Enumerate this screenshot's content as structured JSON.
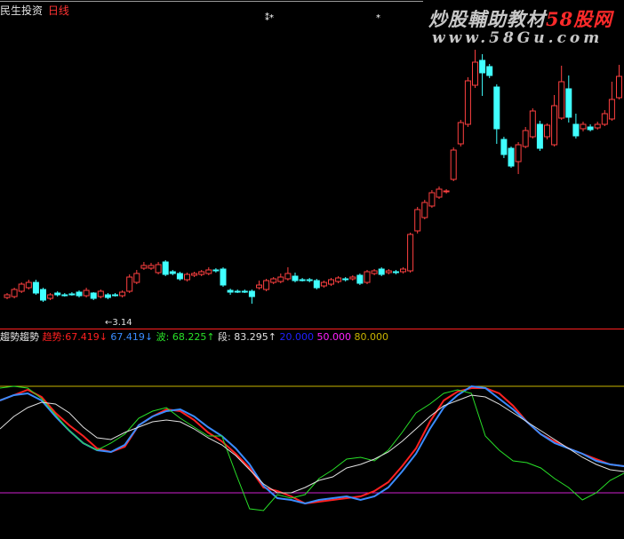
{
  "header": {
    "stock_name": "民生投资",
    "period": "日线"
  },
  "watermark": {
    "line1_white": "炒股輔助教材",
    "line1_red": "58股网",
    "line2": "www.58Gu.com"
  },
  "markers": {
    "star1": "⁑",
    "star2": "*"
  },
  "price_panel": {
    "low_label": "←3.14"
  },
  "indicator": {
    "name": "趨勢趨勢",
    "labels": [
      {
        "text": "趋势:",
        "color": "#ff2020"
      },
      {
        "text": "67.419↓",
        "color": "#ff2020"
      },
      {
        "text": " 67.419↓",
        "color": "#3a8cff"
      },
      {
        "text": " 波: ",
        "color": "#28e028"
      },
      {
        "text": "68.225↑",
        "color": "#28e028"
      },
      {
        "text": " 段: ",
        "color": "#e0e0e0"
      },
      {
        "text": "83.295↑",
        "color": "#e0e0e0"
      },
      {
        "text": " 20.000",
        "color": "#2020ff"
      },
      {
        "text": " 50.000",
        "color": "#ff20ff"
      },
      {
        "text": " 80.000",
        "color": "#c8b400"
      }
    ]
  },
  "chart_data": [
    {
      "type": "candlestick",
      "low_annotation": 3.14,
      "candles": [
        {
          "o": 35,
          "c": 38,
          "h": 40,
          "l": 33,
          "up": true
        },
        {
          "o": 36,
          "c": 44,
          "h": 46,
          "l": 34,
          "up": true
        },
        {
          "o": 42,
          "c": 50,
          "h": 52,
          "l": 40,
          "up": true
        },
        {
          "o": 46,
          "c": 52,
          "h": 55,
          "l": 44,
          "up": true
        },
        {
          "o": 52,
          "c": 40,
          "h": 55,
          "l": 38,
          "up": false
        },
        {
          "o": 44,
          "c": 32,
          "h": 46,
          "l": 30,
          "up": false
        },
        {
          "o": 34,
          "c": 38,
          "h": 40,
          "l": 32,
          "up": true
        },
        {
          "o": 40,
          "c": 38,
          "h": 42,
          "l": 36,
          "up": false
        },
        {
          "o": 38,
          "c": 38,
          "h": 40,
          "l": 36,
          "up": false
        },
        {
          "o": 39,
          "c": 39,
          "h": 41,
          "l": 37,
          "up": false
        },
        {
          "o": 41,
          "c": 37,
          "h": 43,
          "l": 35,
          "up": false
        },
        {
          "o": 37,
          "c": 43,
          "h": 46,
          "l": 35,
          "up": true
        },
        {
          "o": 40,
          "c": 34,
          "h": 41,
          "l": 32,
          "up": false
        },
        {
          "o": 36,
          "c": 42,
          "h": 44,
          "l": 34,
          "up": true
        },
        {
          "o": 38,
          "c": 35,
          "h": 40,
          "l": 33,
          "up": false
        },
        {
          "o": 38,
          "c": 38,
          "h": 40,
          "l": 36,
          "up": false
        },
        {
          "o": 37,
          "c": 41,
          "h": 43,
          "l": 35,
          "up": true
        },
        {
          "o": 42,
          "c": 58,
          "h": 61,
          "l": 40,
          "up": true
        },
        {
          "o": 52,
          "c": 62,
          "h": 66,
          "l": 50,
          "up": true
        },
        {
          "o": 68,
          "c": 71,
          "h": 75,
          "l": 66,
          "up": true
        },
        {
          "o": 68,
          "c": 71,
          "h": 74,
          "l": 66,
          "up": true
        },
        {
          "o": 63,
          "c": 72,
          "h": 75,
          "l": 61,
          "up": true
        },
        {
          "o": 75,
          "c": 61,
          "h": 77,
          "l": 59,
          "up": false
        },
        {
          "o": 64,
          "c": 62,
          "h": 66,
          "l": 60,
          "up": false
        },
        {
          "o": 62,
          "c": 56,
          "h": 64,
          "l": 54,
          "up": false
        },
        {
          "o": 55,
          "c": 61,
          "h": 63,
          "l": 53,
          "up": true
        },
        {
          "o": 60,
          "c": 62,
          "h": 64,
          "l": 58,
          "up": true
        },
        {
          "o": 61,
          "c": 64,
          "h": 66,
          "l": 59,
          "up": true
        },
        {
          "o": 62,
          "c": 66,
          "h": 69,
          "l": 60,
          "up": true
        },
        {
          "o": 66,
          "c": 65,
          "h": 68,
          "l": 63,
          "up": false
        },
        {
          "o": 67,
          "c": 49,
          "h": 69,
          "l": 47,
          "up": false
        },
        {
          "o": 43,
          "c": 41,
          "h": 45,
          "l": 38,
          "up": false
        },
        {
          "o": 42,
          "c": 42,
          "h": 44,
          "l": 40,
          "up": false
        },
        {
          "o": 42,
          "c": 42,
          "h": 44,
          "l": 40,
          "up": false
        },
        {
          "o": 42,
          "c": 36,
          "h": 44,
          "l": 28,
          "up": false
        },
        {
          "o": 46,
          "c": 49,
          "h": 54,
          "l": 44,
          "up": true
        },
        {
          "o": 44,
          "c": 54,
          "h": 56,
          "l": 42,
          "up": true
        },
        {
          "o": 52,
          "c": 56,
          "h": 58,
          "l": 50,
          "up": true
        },
        {
          "o": 53,
          "c": 58,
          "h": 62,
          "l": 51,
          "up": true
        },
        {
          "o": 56,
          "c": 62,
          "h": 69,
          "l": 54,
          "up": true
        },
        {
          "o": 59,
          "c": 54,
          "h": 63,
          "l": 52,
          "up": false
        },
        {
          "o": 55,
          "c": 55,
          "h": 57,
          "l": 53,
          "up": false
        },
        {
          "o": 55,
          "c": 54,
          "h": 57,
          "l": 52,
          "up": false
        },
        {
          "o": 54,
          "c": 46,
          "h": 56,
          "l": 44,
          "up": false
        },
        {
          "o": 48,
          "c": 52,
          "h": 54,
          "l": 46,
          "up": true
        },
        {
          "o": 50,
          "c": 55,
          "h": 57,
          "l": 48,
          "up": true
        },
        {
          "o": 53,
          "c": 57,
          "h": 59,
          "l": 51,
          "up": true
        },
        {
          "o": 56,
          "c": 55,
          "h": 58,
          "l": 53,
          "up": false
        },
        {
          "o": 56,
          "c": 58,
          "h": 60,
          "l": 54,
          "up": true
        },
        {
          "o": 60,
          "c": 51,
          "h": 62,
          "l": 49,
          "up": false
        },
        {
          "o": 52,
          "c": 64,
          "h": 66,
          "l": 50,
          "up": true
        },
        {
          "o": 62,
          "c": 65,
          "h": 67,
          "l": 60,
          "up": true
        },
        {
          "o": 67,
          "c": 61,
          "h": 69,
          "l": 59,
          "up": false
        },
        {
          "o": 63,
          "c": 65,
          "h": 67,
          "l": 61,
          "up": true
        },
        {
          "o": 64,
          "c": 63,
          "h": 66,
          "l": 61,
          "up": false
        },
        {
          "o": 64,
          "c": 67,
          "h": 69,
          "l": 62,
          "up": true
        },
        {
          "o": 65,
          "c": 106,
          "h": 108,
          "l": 63,
          "up": true
        },
        {
          "o": 110,
          "c": 134,
          "h": 137,
          "l": 107,
          "up": true
        },
        {
          "o": 125,
          "c": 142,
          "h": 145,
          "l": 123,
          "up": true
        },
        {
          "o": 138,
          "c": 153,
          "h": 156,
          "l": 136,
          "up": true
        },
        {
          "o": 148,
          "c": 157,
          "h": 160,
          "l": 146,
          "up": true
        },
        {
          "o": 154,
          "c": 155,
          "h": 157,
          "l": 152,
          "up": true
        },
        {
          "o": 168,
          "c": 201,
          "h": 204,
          "l": 166,
          "up": true
        },
        {
          "o": 208,
          "c": 232,
          "h": 235,
          "l": 205,
          "up": true
        },
        {
          "o": 230,
          "c": 279,
          "h": 283,
          "l": 227,
          "up": true
        },
        {
          "o": 274,
          "c": 300,
          "h": 314,
          "l": 271,
          "up": true
        },
        {
          "o": 302,
          "c": 288,
          "h": 309,
          "l": 262,
          "up": false
        },
        {
          "o": 295,
          "c": 285,
          "h": 298,
          "l": 282,
          "up": false
        },
        {
          "o": 272,
          "c": 225,
          "h": 275,
          "l": 208,
          "up": false
        },
        {
          "o": 213,
          "c": 196,
          "h": 216,
          "l": 192,
          "up": false
        },
        {
          "o": 203,
          "c": 183,
          "h": 205,
          "l": 181,
          "up": false
        },
        {
          "o": 188,
          "c": 207,
          "h": 210,
          "l": 174,
          "up": true
        },
        {
          "o": 205,
          "c": 223,
          "h": 227,
          "l": 203,
          "up": true
        },
        {
          "o": 216,
          "c": 245,
          "h": 248,
          "l": 214,
          "up": true
        },
        {
          "o": 230,
          "c": 203,
          "h": 234,
          "l": 200,
          "up": false
        },
        {
          "o": 216,
          "c": 229,
          "h": 231,
          "l": 213,
          "up": true
        },
        {
          "o": 207,
          "c": 251,
          "h": 263,
          "l": 205,
          "up": true
        },
        {
          "o": 237,
          "c": 278,
          "h": 296,
          "l": 235,
          "up": true
        },
        {
          "o": 270,
          "c": 238,
          "h": 285,
          "l": 232,
          "up": false
        },
        {
          "o": 230,
          "c": 217,
          "h": 242,
          "l": 214,
          "up": false
        },
        {
          "o": 225,
          "c": 230,
          "h": 233,
          "l": 222,
          "up": true
        },
        {
          "o": 227,
          "c": 224,
          "h": 230,
          "l": 222,
          "up": false
        },
        {
          "o": 226,
          "c": 230,
          "h": 233,
          "l": 224,
          "up": true
        },
        {
          "o": 230,
          "c": 242,
          "h": 246,
          "l": 228,
          "up": true
        },
        {
          "o": 236,
          "c": 258,
          "h": 278,
          "l": 234,
          "up": true
        },
        {
          "o": 260,
          "c": 284,
          "h": 297,
          "l": 258,
          "up": true
        }
      ]
    },
    {
      "type": "line",
      "levels": [
        20,
        50,
        80
      ],
      "series": [
        {
          "color": "#ff2020",
          "values": [
            72,
            75,
            78,
            74,
            65,
            58,
            52,
            45,
            43,
            46,
            58,
            63,
            67,
            66,
            61,
            54,
            49,
            42,
            34,
            23,
            21,
            18,
            14,
            15,
            16,
            17,
            18,
            21,
            26,
            35,
            45,
            60,
            72,
            77,
            79,
            79,
            76,
            69,
            60,
            53,
            49,
            45,
            42,
            39,
            36,
            35
          ]
        },
        {
          "color": "#3a8cff",
          "values": [
            72,
            75,
            76,
            72,
            63,
            55,
            48,
            44,
            43,
            47,
            58,
            63,
            66,
            67,
            63,
            57,
            52,
            45,
            36,
            24,
            17,
            16,
            14,
            16,
            17,
            18,
            16,
            18,
            23,
            32,
            42,
            56,
            68,
            75,
            80,
            79,
            73,
            67,
            60,
            53,
            48,
            45,
            42,
            38,
            36,
            35
          ]
        },
        {
          "color": "#28e028",
          "values": [
            79,
            80,
            79,
            73,
            64,
            55,
            48,
            44,
            48,
            53,
            62,
            66,
            68,
            62,
            57,
            52,
            52,
            31,
            11,
            10,
            19,
            17,
            19,
            28,
            33,
            39,
            40,
            38,
            44,
            54,
            65,
            70,
            76,
            78,
            76,
            52,
            44,
            38,
            37,
            34,
            28,
            23,
            16,
            20,
            27,
            31
          ]
        },
        {
          "color": "#e0e0e0",
          "values": [
            56,
            63,
            68,
            71,
            70,
            65,
            57,
            51,
            50,
            54,
            57,
            60,
            61,
            60,
            56,
            51,
            47,
            41,
            33,
            25,
            20,
            20,
            23,
            27,
            29,
            34,
            36,
            39,
            43,
            49,
            56,
            63,
            69,
            72,
            75,
            74,
            70,
            65,
            60,
            55,
            50,
            45,
            40,
            36,
            33,
            32
          ]
        }
      ]
    }
  ]
}
